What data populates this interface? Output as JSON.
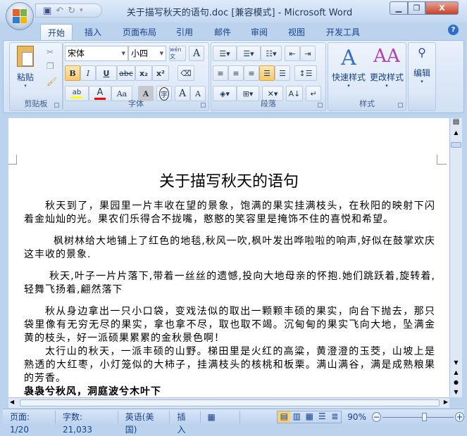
{
  "window": {
    "title": "关于描写秋天的语句.doc [兼容模式] - Microsoft Word",
    "minimize": "▁",
    "restore": "❐",
    "close": "X"
  },
  "tabs": [
    "开始",
    "插入",
    "页面布局",
    "引用",
    "邮件",
    "审阅",
    "视图",
    "开发工具"
  ],
  "help": "?",
  "ribbon": {
    "clipboard": {
      "label": "剪贴板",
      "paste": "粘贴"
    },
    "font": {
      "label": "字体",
      "font_name": "宋体",
      "font_size": "小四",
      "bold": "B",
      "italic": "I",
      "underline": "U",
      "strike": "abc",
      "subscript": "x₂",
      "superscript": "x²",
      "change_case": "Aa",
      "grow": "A",
      "shrink": "A",
      "phonetic": "wén文",
      "border_char": "A",
      "shade_char": "A",
      "enclose": "字",
      "highlight": "ab",
      "font_color": "A",
      "highlight_color": "#ffff00",
      "font_color_value": "#ff0000"
    },
    "paragraph": {
      "label": "段落"
    },
    "styles": {
      "label": "样式",
      "quick": "快速样式",
      "change": "更改样式"
    },
    "editing": {
      "label": "编辑"
    }
  },
  "document": {
    "title": "关于描写秋天的语句",
    "paragraphs": [
      "秋天到了，果园里一片丰收在望的景象，饱满的果实挂满枝头，在秋阳的映射下闪着金灿灿的光。果农们乐得合不拢嘴，憨憨的笑容里是掩饰不住的喜悦和希望。",
      "枫树林给大地铺上了红色的地毯,秋风一吹,枫叶发出哗啦啦的响声,好似在鼓掌欢庆这丰收的景象.",
      "秋天,叶子一片片落下,带着一丝丝的遗憾,投向大地母亲的怀抱.她们跳跃着,旋转着,轻舞飞扬着,翩然落下",
      "秋从身边拿出一只小口袋，变戏法似的取出一颗颗丰硕的果实，向台下抛去，那只袋里像有无穷无尽的果实，拿也拿不尽，取也取不竭。沉甸甸的果实飞向大地，坠满金黄的枝头，好一派硕果累累的金秋景色啊！",
      "太行山的秋天，一派丰硕的山野。梯田里是火红的高粱，黄澄澄的玉茭，山坡上是熟透的大红枣，小灯笼似的大柿子，挂满枝头的核桃和板栗。满山满谷，满是成熟粮果的芳香。",
      "袅袅兮秋风，洞庭波兮木叶下"
    ]
  },
  "status": {
    "page": "页面: 1/20",
    "words": "字数: 21,033",
    "language": "英语(美国)",
    "mode": "插入",
    "zoom": "90%",
    "zoom_minus": "−",
    "zoom_plus": "+",
    "zoom_level_percent": 90
  }
}
